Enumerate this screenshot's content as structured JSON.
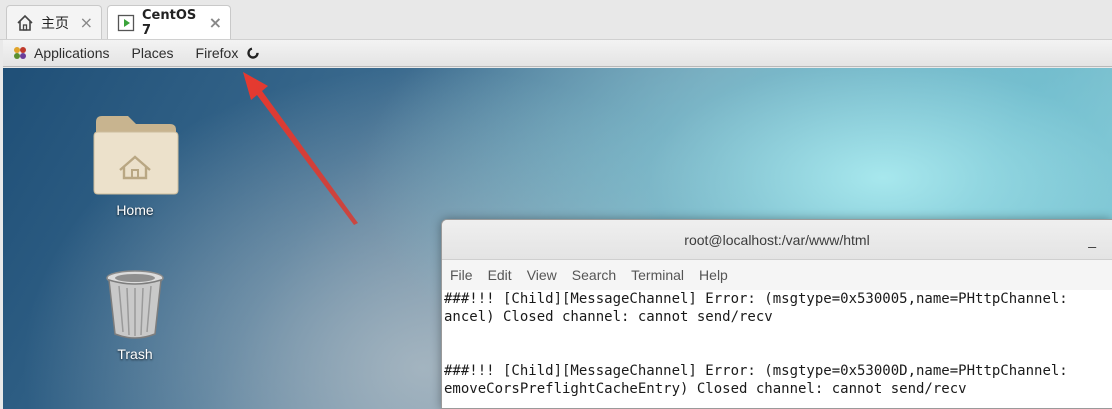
{
  "host_tabs": [
    {
      "label": "主页",
      "icon": "home-icon"
    },
    {
      "label": "CentOS 7",
      "icon": "vm-play-icon"
    }
  ],
  "gnome_bar": {
    "applications": "Applications",
    "places": "Places",
    "firefox": "Firefox"
  },
  "desktop_icons": {
    "home": "Home",
    "trash": "Trash"
  },
  "terminal": {
    "title": "root@localhost:/var/www/html",
    "minimize": "_",
    "menu": [
      "File",
      "Edit",
      "View",
      "Search",
      "Terminal",
      "Help"
    ],
    "lines": [
      "###!!! [Child][MessageChannel] Error: (msgtype=0x530005,name=PHttpChannel:",
      "ancel) Closed channel: cannot send/recv",
      "",
      "",
      "###!!! [Child][MessageChannel] Error: (msgtype=0x53000D,name=PHttpChannel:",
      "emoveCorsPreflightCacheEntry) Closed channel: cannot send/recv"
    ]
  },
  "colors": {
    "arrow": "#e8392f",
    "vm_tab_accent": "#3aa33a"
  }
}
